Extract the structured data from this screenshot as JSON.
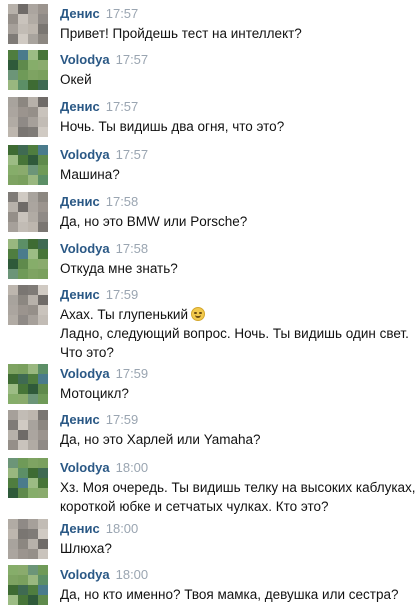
{
  "colors": {
    "name": "#2a5885",
    "time": "#9aa5b1",
    "text": "#111111",
    "background": "#ffffff"
  },
  "messages": [
    {
      "author": "Денис",
      "time": "17:57",
      "avatar": "denis",
      "lines": [
        "Привет! Пройдешь тест на интеллект?"
      ]
    },
    {
      "author": "Volodya",
      "time": "17:57",
      "avatar": "volodya",
      "lines": [
        "Окей"
      ]
    },
    {
      "author": "Денис",
      "time": "17:57",
      "avatar": "denis",
      "lines": [
        "Ночь. Ты видишь два огня, что это?"
      ]
    },
    {
      "author": "Volodya",
      "time": "17:57",
      "avatar": "volodya",
      "lines": [
        "Машина?"
      ]
    },
    {
      "author": "Денис",
      "time": "17:58",
      "avatar": "denis",
      "lines": [
        "Да, но это BMW или Porsche?"
      ]
    },
    {
      "author": "Volodya",
      "time": "17:58",
      "avatar": "volodya",
      "lines": [
        "Откуда мне знать?"
      ]
    },
    {
      "author": "Денис",
      "time": "17:59",
      "avatar": "denis",
      "emoji": "laughing-face-icon",
      "lines": [
        "Ахах. Ты глупенький",
        "Ладно, следующий вопрос. Ночь. Ты видишь один свет.",
        "Что это?"
      ]
    },
    {
      "author": "Volodya",
      "time": "17:59",
      "avatar": "volodya",
      "lines": [
        "Мотоцикл?"
      ]
    },
    {
      "author": "Денис",
      "time": "17:59",
      "avatar": "denis",
      "lines": [
        "Да, но это Харлей или Yamaha?"
      ]
    },
    {
      "author": "Volodya",
      "time": "18:00",
      "avatar": "volodya",
      "lines": [
        "Хз. Моя очередь. Ты видишь телку на высоких каблуках, в",
        "короткой юбке и сетчатых чулках. Кто это?"
      ]
    },
    {
      "author": "Денис",
      "time": "18:00",
      "avatar": "denis",
      "lines": [
        "Шлюха?"
      ]
    },
    {
      "author": "Volodya",
      "time": "18:00",
      "avatar": "volodya",
      "lines": [
        "Да, но кто именно? Твоя мамка, девушка или сестра?"
      ]
    }
  ]
}
